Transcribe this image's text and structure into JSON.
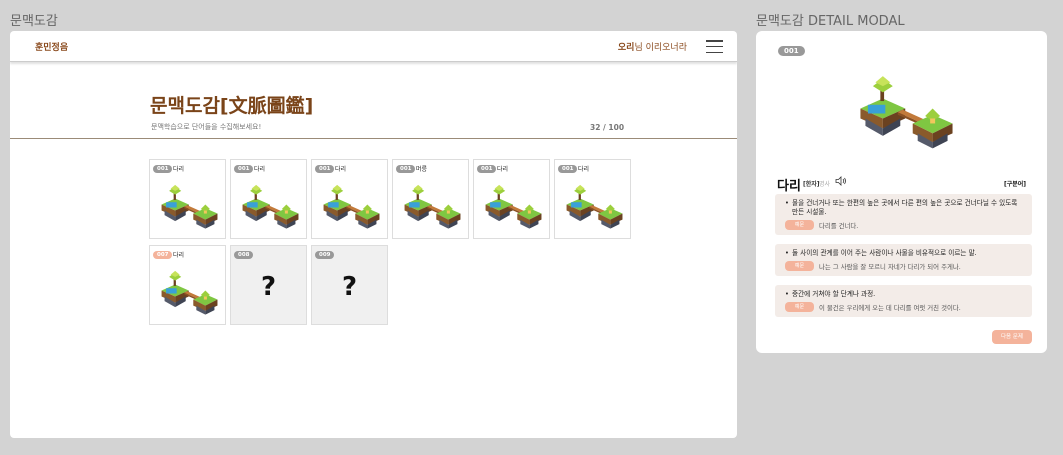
{
  "frames": {
    "main_title": "문맥도감",
    "modal_title": "문맥도감 DETAIL MODAL"
  },
  "header": {
    "brand": "훈민정음",
    "user_name": "오리",
    "greeting_suffix": "님 이리오너라"
  },
  "page": {
    "title": "문맥도감[文脈圖鑑]",
    "subtitle": "문맥학습으로 단어들을 수집해보세요!",
    "progress": "32 / 100"
  },
  "cards": [
    {
      "num": "001",
      "name": "다리",
      "unlocked": true,
      "highlight": false
    },
    {
      "num": "001",
      "name": "다리",
      "unlocked": true,
      "highlight": false
    },
    {
      "num": "001",
      "name": "다리",
      "unlocked": true,
      "highlight": false
    },
    {
      "num": "001",
      "name": "머릉",
      "unlocked": true,
      "highlight": false
    },
    {
      "num": "001",
      "name": "다리",
      "unlocked": true,
      "highlight": false
    },
    {
      "num": "001",
      "name": "다리",
      "unlocked": true,
      "highlight": false
    },
    {
      "num": "007",
      "name": "다리",
      "unlocked": true,
      "highlight": true
    },
    {
      "num": "008",
      "name": "",
      "unlocked": false,
      "placeholder": "?"
    },
    {
      "num": "009",
      "name": "",
      "unlocked": false,
      "placeholder": "?"
    }
  ],
  "modal": {
    "num": "001",
    "word": "다리",
    "hanja": "[한자]",
    "pos": "명사",
    "icon": "speaker-icon",
    "tag": "[구분어]",
    "example_chip": "예문",
    "senses": [
      {
        "definition": "물을 건너거나 또는 한편의 높은 곳에서 다른 편의 높은 곳으로 건너다닐 수 있도록 만든 시설물.",
        "example": "다리를 건너다."
      },
      {
        "definition": "둘 사이의 관계를 이어 주는 사람이나 사물을 비유적으로 이르는 말.",
        "example": "나는 그 사람을 잘 모르니 자네가 다리가 되어 주게나."
      },
      {
        "definition": "중간에 거쳐야 할 단계나 과정.",
        "example": "이 물건은 우리에게 오는 데 다리를 여럿 거친 것이다."
      }
    ],
    "next_button": "다음 문제"
  },
  "colors": {
    "accent_brown": "#7a4419",
    "chip_salmon": "#f4b39b",
    "badge_gray": "#999999",
    "sense_bg": "#f3ece8"
  }
}
